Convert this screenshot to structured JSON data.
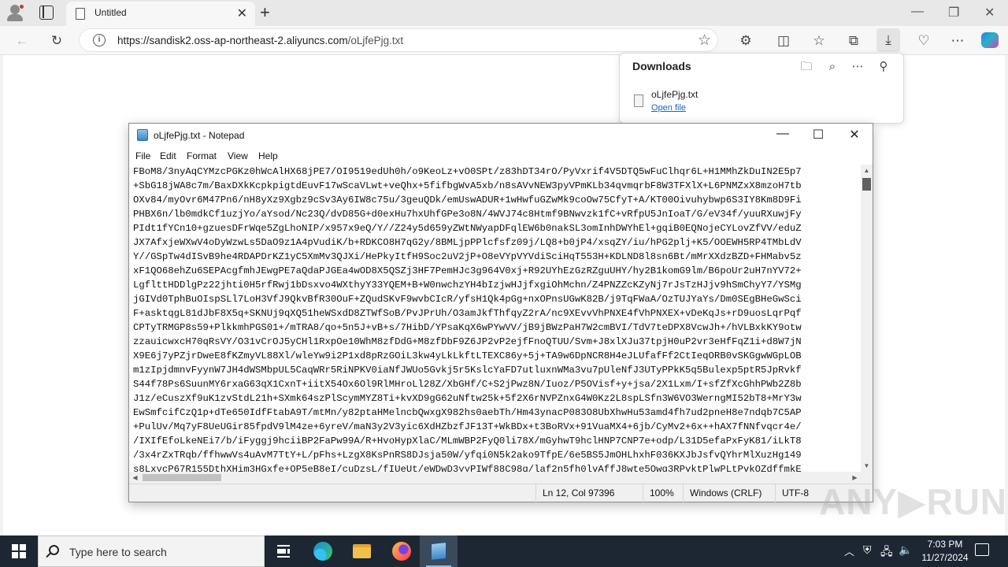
{
  "browser": {
    "tab_title": "Untitled",
    "new_tab_symbol": "+",
    "window_controls": {
      "minimize": "—",
      "maximize": "❐",
      "close": "✕"
    },
    "url_host": "https://sandisk2.oss-ap-northeast-2.aliyuncs.com",
    "url_path": "/oLjfePjg.txt"
  },
  "downloads": {
    "title": "Downloads",
    "file_name": "oLjfePjg.txt",
    "open_file_label": "Open file"
  },
  "notepad": {
    "window_title": "oLjfePjg.txt - Notepad",
    "menu": [
      "File",
      "Edit",
      "Format",
      "View",
      "Help"
    ],
    "lines": [
      "FBoM8/3nyAqCYMzcPGKz0hWcAlHX68jPE7/OI9519edUh0h/o9KeoLz+vO0SPt/z83hDT34rO/PyVxrif4V5DTQ5wFuClhqr6L+H1MMhZkDuIN2E5p7",
      "+SbG18jWA8c7m/BaxDXkKcpkpigtdEuvF17wScaVLwt+veQhx+5fifbgWvA5xb/n8sAVvNEW3pyVPmKLb34qvmqrbF8W3TFXlX+L6PNMZxX8mzoH7tb",
      "OXv84/myOvr6M47Pn6/nH8yXz9Xgbz9cSv3Ay6IW8c75u/3geuQDk/emUswADUR+1wHwfuGZwMk9coOw75CfyT+A/KT00Oivuhybwp6S3IY8Km8D9Fi",
      "PHBX6n/lb0mdkCf1uzjYo/aYsod/Nc23Q/dvD85G+d0exHu7hxUhfGPe3o8N/4WVJ74c8Htmf9BNwvzk1fC+vRfpU5JnIoaT/G/eV34f/yuuRXuwjFy",
      "PIdt1fYCn10+gzuesDFrWqe5ZgLhoNIP/x957x9eQ/Y//Z24y5d659yZWtNWyapDFqlEW6b0nakSL3omInhDWYhEl+gqiB0EQNojeCYLovZfVV/eduZ",
      "JX7AfxjeWXwV4oDyWzwLs5DaO9z1A4pVudiK/b+RDKCO8H7qG2y/8BMLjpPPlcfsfz09j/LQ8+b0jP4/xsqZY/iu/hPG2plj+K5/OOEWH5RP4TMbLdV",
      "Y//GSpTw4dISvB9he4RDAPDrKZ1yC5XmMv3QJXi/HePkyItfH9Soc2uV2jP+O8eVYpVYVdiSciHqT553H+KDLND8l8sn6Bt/mMrXXdzBZD+FHMabv5z",
      "xF1QO68ehZu6SEPAcgfmhJEwgPE7aQdaPJGEa4wOD8X5QSZj3HF7PemHJc3g964V0xj+R92UYhEzGzRZguUHY/hy2B1komG9lm/B6poUr2uH7nYV72+",
      "LgflttHDDlgPz22jhti0H5rfRwj1bDsxvo4WXthyY33YQEM+B+W0nwchzYH4bIzjwHJjfxgiOhMchn/Z4PNZZcKZyNj7rJsTzHJjv9hSmChyY7/YSMg",
      "jGIVd0TphBuOIspSLl7LoH3VfJ9QkvBfR30OuF+ZQudSKvF9wvbCIcR/yfsH1Qk4pGg+nxOPnsUGwK82B/j9TqFWaA/OzTUJYaYs/Dm0SEgBHeGwSci",
      "F+asktqgL81dJbF8X5q+SKNUj9qXQ51heWSxdD8ZTWfSoB/PvJPrUh/O3amJkfThfqyZ2rA/nc9XEvvVhPNXE4fVhPNXEX+vDeKqJs+rD9uosLqrPqf",
      "CPTyTRMGP8s59+PlkkmhPGS01+/mTRA8/qo+5n5J+vB+s/7HibD/YPsaKqX6wPYwVV/jB9jBWzPaH7W2cmBVI/TdV7teDPX8VcwJh+/hVLBxkKY9otw",
      "zzauicwxcH70qRsVY/O31vCrOJ5yCHl1RxpOe10WhM8zfDdG+M8zfDbF9Z6JP2vP2ejfFnoQTUU/Svm+J8xlXJu37tpjH0uP2vr3eHfFqZ1i+d8W7jN",
      "X9E6j7yPZjrDweE8fKZmyVL88Xl/wleYw9i2P1xd8pRzGOiL3kw4yLkLkftLTEXC86y+5j+TA9w6DpNCR8H4eJLUfafFf2CtIeqORB0vSKGgwWGpLOB",
      "m1zIpjdmnvFyynW7JH4dWSMbpUL5CaqWRr5RiNPKV0iaNfJWUo5Gvkj5r5KslcYaFD7utluxnWMa3vu7pUleNfJ3UTyPPkK5q5Bulexp5ptR5JpRvkf",
      "S44f78Ps6SuunMY6rxaG63qX1CxnT+iitX54Ox6Ol9RlMHroLl28Z/XbGHf/C+S2jPwz8N/Iuoz/P5OVisf+y+jsa/2X1Lxm/I+sfZfXcGhhPWb2Z8b",
      "J1z/eCuszXf9uK1zvStdL21h+SXmk64szPlScymMYZ8Ti+kvXD9gG62uNftw25k+5f2X6rNVPZnxG4W0Kz2L8spLSfn3W6VO3WerngMI52bT8+MrY3w",
      "EwSmfcifCzQ1p+dTe650IdfFtabA9T/mtMn/y82ptaHMelncbQwxgX982hs0aebTh/Hm43ynacP083O8UbXhwHu53amd4fh7ud2pneH8e7ndqb7C5AP",
      "+PulUv/Mq7yF8UeUGir85fpdV9lM4ze+6yreV/maN3y2V3yic6XdHZbzfJF13T+WkBDx+t3BoRVx+91VuaMX4+6jb/CyMv2+6x++hAX7fNNfvqcr4e/",
      "/IXIfEfoLkeNEi7/b/iFyggj9hciiBP2FaPw99A/R+HvoHypXlaC/MLmWBP2FyQ0li78X/mGyhwT9hclHNP7CNP7e+odp/L31D5efaPxFyK81/iLkT8",
      "/3x4rZxTRqb/ffhwwVs4uAvM7TtY+L/pFhs+LzgX8KsPnRS8DJsja50W/yfqi0N5k2ako9TfpE/6e5BS5JmOHLhxhF036KXJbJsfvQYhrMlXuzHg149",
      "s8LxycP67R155DthXHim3HGxfe+OP5eB8eI/cuDzsL/fIUeUt/eWDwD3yyPIWf88C98q/laf2n5fh0lvAffJ8wte5Owq3RPvktPlwPLtPvkOZdffmkE"
    ],
    "status": {
      "position": "Ln 12, Col 97396",
      "zoom": "100%",
      "line_ending": "Windows (CRLF)",
      "encoding": "UTF-8"
    }
  },
  "watermark": "ANY▶RUN",
  "taskbar": {
    "search_placeholder": "Type here to search",
    "time": "7:03 PM",
    "date": "11/27/2024"
  }
}
